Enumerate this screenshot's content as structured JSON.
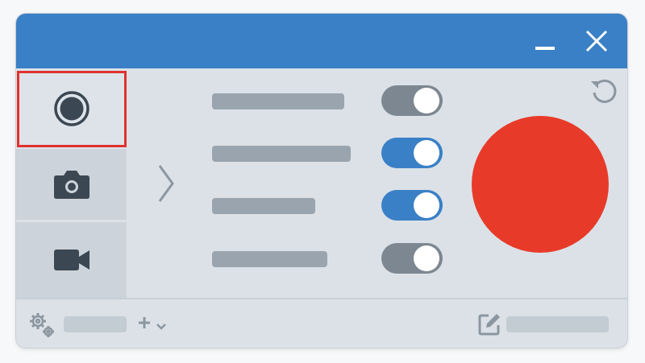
{
  "window": {
    "minimize_icon": "minimize-icon",
    "close_icon": "close-icon",
    "accent_color": "#3a80c6"
  },
  "sidebar": {
    "items": [
      {
        "id": "record",
        "icon": "record-icon",
        "selected": true
      },
      {
        "id": "screenshot",
        "icon": "camera-icon",
        "selected": false
      },
      {
        "id": "video",
        "icon": "video-camera-icon",
        "selected": false
      }
    ],
    "highlight_color": "#e0322d"
  },
  "expand_icon": "chevron-right-icon",
  "options": [
    {
      "enabled": false
    },
    {
      "enabled": true
    },
    {
      "enabled": true
    },
    {
      "enabled": false
    }
  ],
  "record_button": {
    "icon": "record-button",
    "color": "#e83a29"
  },
  "reset_icon": "reset-icon",
  "footer": {
    "settings_icon": "gears-icon",
    "add_icon": "plus-icon",
    "dropdown_icon": "caret-down-icon",
    "edit_icon": "edit-icon"
  }
}
